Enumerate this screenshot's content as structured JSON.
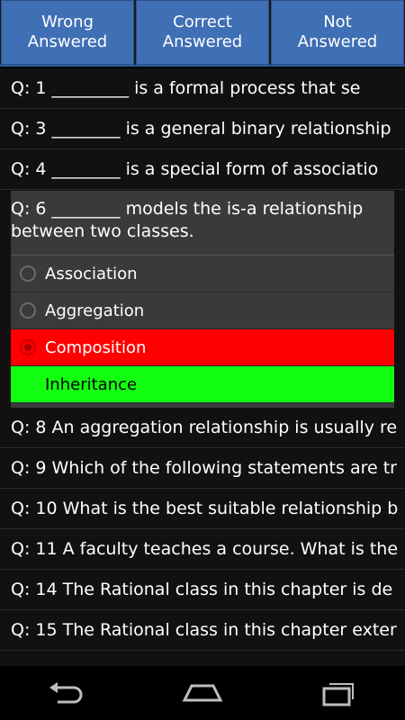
{
  "tabs": [
    {
      "label_line1": "Wrong",
      "label_line2": "Answered"
    },
    {
      "label_line1": "Correct",
      "label_line2": "Answered"
    },
    {
      "label_line1": "Not",
      "label_line2": "Answered"
    }
  ],
  "questions_before": [
    {
      "text": "Q: 1 _________ is a formal process that se"
    },
    {
      "text": "Q: 3 ________ is a general binary relationship"
    },
    {
      "text": "Q: 4 ________ is a special form of associatio"
    }
  ],
  "expanded": {
    "title": "Q: 6 ________ models the is-a relationship between two classes.",
    "options": [
      {
        "label": "Association",
        "state": "none"
      },
      {
        "label": "Aggregation",
        "state": "none"
      },
      {
        "label": "Composition",
        "state": "wrong"
      },
      {
        "label": "Inheritance",
        "state": "correct"
      }
    ]
  },
  "questions_after": [
    {
      "text": "Q: 8 An aggregation relationship is usually re"
    },
    {
      "text": "Q: 9 Which of the following statements are tr"
    },
    {
      "text": "Q: 10 What is the best suitable relationship b"
    },
    {
      "text": "Q: 11 A faculty teaches a course. What is the"
    },
    {
      "text": "Q: 14 The Rational class in this chapter is de"
    },
    {
      "text": "Q: 15 The Rational class in this chapter exter"
    }
  ],
  "colors": {
    "wrong": "#ff0000",
    "correct": "#12ff12",
    "tab": "#3f6fb4"
  },
  "nav": {
    "back": "back-icon",
    "home": "home-icon",
    "recents": "recents-icon"
  }
}
